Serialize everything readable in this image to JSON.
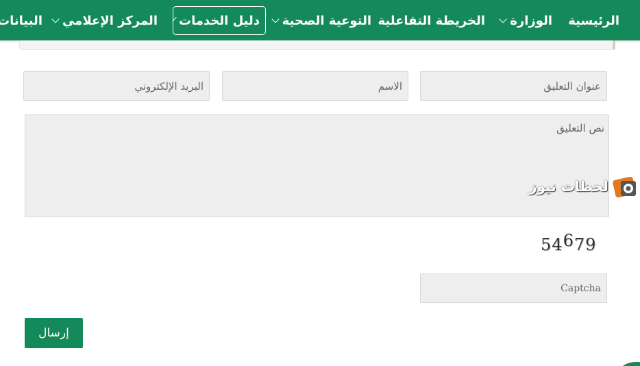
{
  "nav": {
    "items": [
      {
        "label": "الرئيسية"
      },
      {
        "label": "الوزارة"
      },
      {
        "label": "الخريطة التفاعلية"
      },
      {
        "label": "التوعية الصحية"
      },
      {
        "label": "دليل الخدمات"
      },
      {
        "label": "المركز الإعلامي"
      },
      {
        "label": "البيانات"
      }
    ]
  },
  "form": {
    "title_placeholder": "عنوان التعليق",
    "name_placeholder": "الاسم",
    "email_placeholder": "البريد الإلكتروني",
    "body_placeholder": "نص التعليق",
    "captcha_digits": [
      "5",
      "4",
      "6",
      "7",
      "9"
    ],
    "captcha_placeholder": "Captcha",
    "submit_label": "إرسال"
  },
  "watermark": {
    "text": "لحظات نيوز",
    "logo_icon": "camera-logo-icon"
  },
  "colors": {
    "brand": "#14895a",
    "field_bg": "#eeeeee"
  }
}
